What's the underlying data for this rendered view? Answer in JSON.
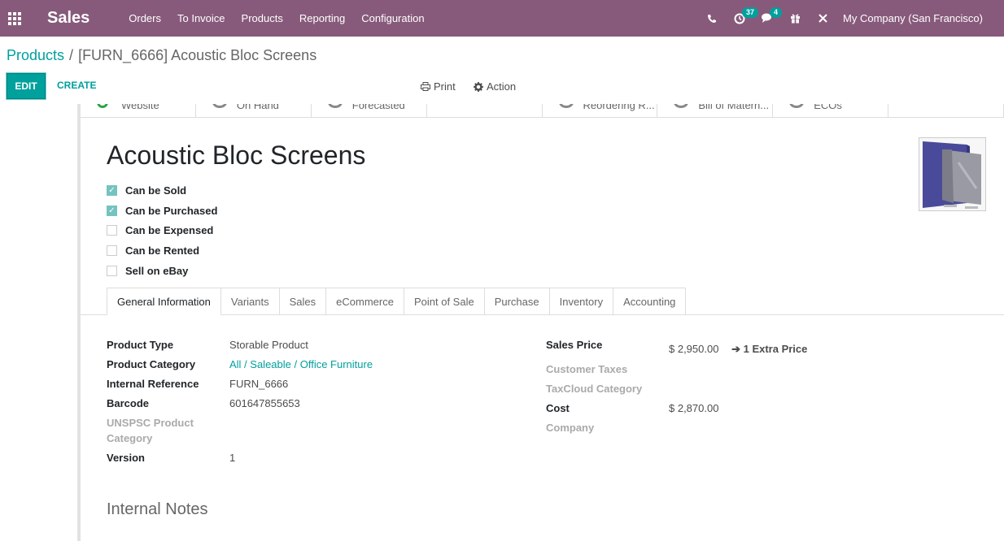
{
  "topnav": {
    "app_name": "Sales",
    "menu": [
      "Orders",
      "To Invoice",
      "Products",
      "Reporting",
      "Configuration"
    ],
    "activity_count": "37",
    "message_count": "4",
    "company": "My Company (San Francisco)"
  },
  "breadcrumb": {
    "parent": "Products",
    "separator": "/",
    "current": "[FURN_6666] Acoustic Bloc Screens"
  },
  "toolbar": {
    "edit_label": "EDIT",
    "create_label": "CREATE",
    "print_label": "Print",
    "action_label": "Action"
  },
  "stat_buttons": [
    "Website",
    "On Hand",
    "Forecasted",
    "",
    "Reordering R...",
    "Bill of Matern...",
    "ECOs"
  ],
  "product": {
    "name": "Acoustic Bloc Screens"
  },
  "checkboxes": [
    {
      "label": "Can be Sold",
      "checked": true
    },
    {
      "label": "Can be Purchased",
      "checked": true
    },
    {
      "label": "Can be Expensed",
      "checked": false
    },
    {
      "label": "Can be Rented",
      "checked": false
    },
    {
      "label": "Sell on eBay",
      "checked": false
    }
  ],
  "tabs": [
    "General Information",
    "Variants",
    "Sales",
    "eCommerce",
    "Point of Sale",
    "Purchase",
    "Inventory",
    "Accounting"
  ],
  "general": {
    "product_type_label": "Product Type",
    "product_type": "Storable Product",
    "product_category_label": "Product Category",
    "product_category": "All / Saleable / Office Furniture",
    "internal_reference_label": "Internal Reference",
    "internal_reference": "FURN_6666",
    "barcode_label": "Barcode",
    "barcode": "601647855653",
    "unspsc_label": "UNSPSC Product Category",
    "version_label": "Version",
    "version": "1",
    "sales_price_label": "Sales Price",
    "sales_price": "$ 2,950.00",
    "extra_price": "1 Extra Price",
    "customer_taxes_label": "Customer Taxes",
    "taxcloud_label": "TaxCloud Category",
    "cost_label": "Cost",
    "cost": "$ 2,870.00",
    "company_label": "Company"
  },
  "notes": {
    "title": "Internal Notes"
  },
  "colors": {
    "brand": "#875a7b",
    "accent": "#00a09d"
  }
}
